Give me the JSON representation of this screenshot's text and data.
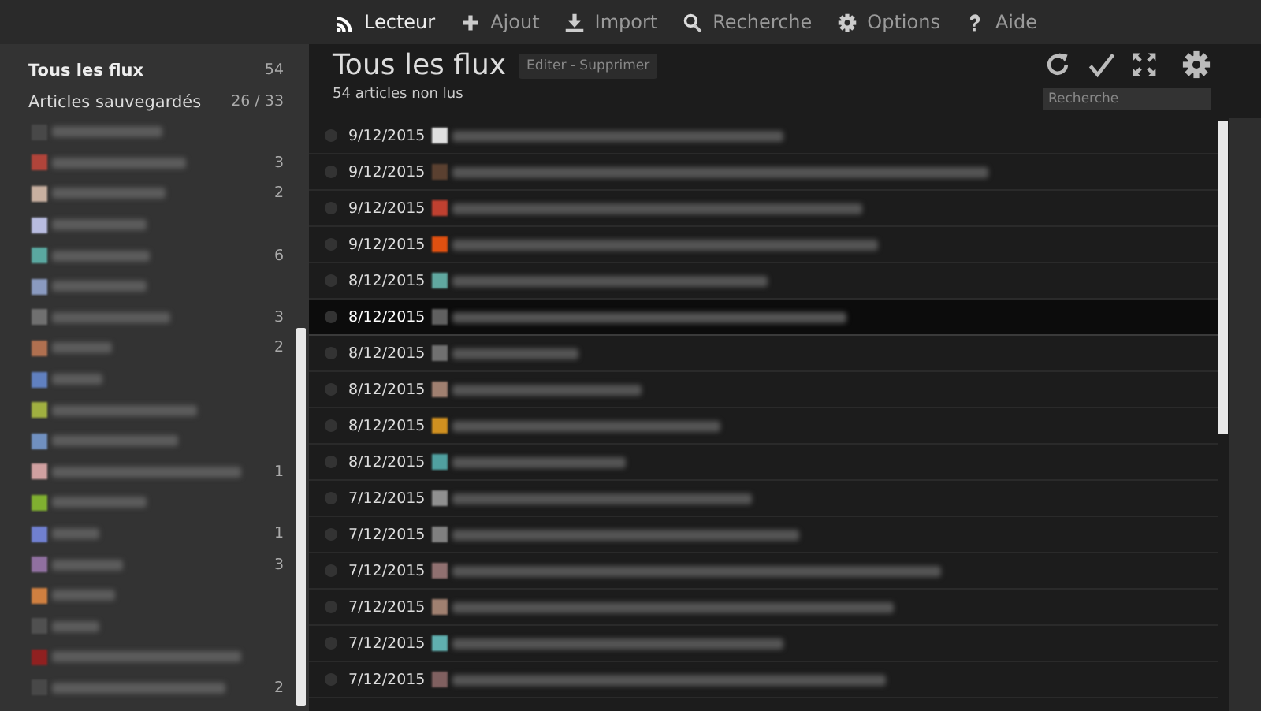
{
  "top_menu": [
    {
      "label": "Lecteur",
      "selected": true
    },
    {
      "label": "Ajout",
      "selected": false
    },
    {
      "label": "Import",
      "selected": false
    },
    {
      "label": "Recherche",
      "selected": false
    },
    {
      "label": "Options",
      "selected": false
    },
    {
      "label": "Aide",
      "selected": false
    }
  ],
  "sidebar": {
    "all_feeds": {
      "label": "Tous les flux",
      "count": "54"
    },
    "saved": {
      "label": "Articles sauvegardés",
      "count": "26 / 33"
    },
    "feeds": [
      {
        "color": "#484848"
      },
      {
        "color": "#b0443a",
        "count": "3"
      },
      {
        "color": "#c8b0a0",
        "count": "2"
      },
      {
        "color": "#b8bce0"
      },
      {
        "color": "#5aa8a0",
        "count": "6"
      },
      {
        "color": "#8a9ac0"
      },
      {
        "color": "#707070",
        "count": "3"
      },
      {
        "color": "#b07050",
        "count": "2"
      },
      {
        "color": "#6080c0"
      },
      {
        "color": "#a0b040"
      },
      {
        "color": "#7090c0"
      },
      {
        "color": "#d0a0a0",
        "count": "1"
      },
      {
        "color": "#80b030"
      },
      {
        "color": "#7080d0",
        "count": "1"
      },
      {
        "color": "#9070a0",
        "count": "3"
      },
      {
        "color": "#d08040"
      },
      {
        "color": "#505050"
      },
      {
        "color": "#902020"
      },
      {
        "color": "#484848",
        "count": "2"
      }
    ]
  },
  "main": {
    "title": "Tous les flux",
    "actions": "Editer - Supprimer",
    "unread": "54 articles non lus",
    "search": {
      "placeholder": "Recherche"
    },
    "articles": [
      {
        "date": "9/12/2015",
        "color": "#e0e0e0",
        "selected": false
      },
      {
        "date": "9/12/2015",
        "color": "#5a4030",
        "selected": false
      },
      {
        "date": "9/12/2015",
        "color": "#c04030",
        "selected": false
      },
      {
        "date": "9/12/2015",
        "color": "#e05010",
        "selected": false
      },
      {
        "date": "8/12/2015",
        "color": "#60a8a0",
        "selected": false
      },
      {
        "date": "8/12/2015",
        "color": "#606060",
        "selected": true
      },
      {
        "date": "8/12/2015",
        "color": "#707070",
        "selected": false
      },
      {
        "date": "8/12/2015",
        "color": "#a08070",
        "selected": false
      },
      {
        "date": "8/12/2015",
        "color": "#d09020",
        "selected": false
      },
      {
        "date": "8/12/2015",
        "color": "#50a0a0",
        "selected": false
      },
      {
        "date": "7/12/2015",
        "color": "#909090",
        "selected": false
      },
      {
        "date": "7/12/2015",
        "color": "#808080",
        "selected": false
      },
      {
        "date": "7/12/2015",
        "color": "#907070",
        "selected": false
      },
      {
        "date": "7/12/2015",
        "color": "#a08070",
        "selected": false
      },
      {
        "date": "7/12/2015",
        "color": "#60b0b0",
        "selected": false
      },
      {
        "date": "7/12/2015",
        "color": "#806060",
        "selected": false
      }
    ]
  }
}
